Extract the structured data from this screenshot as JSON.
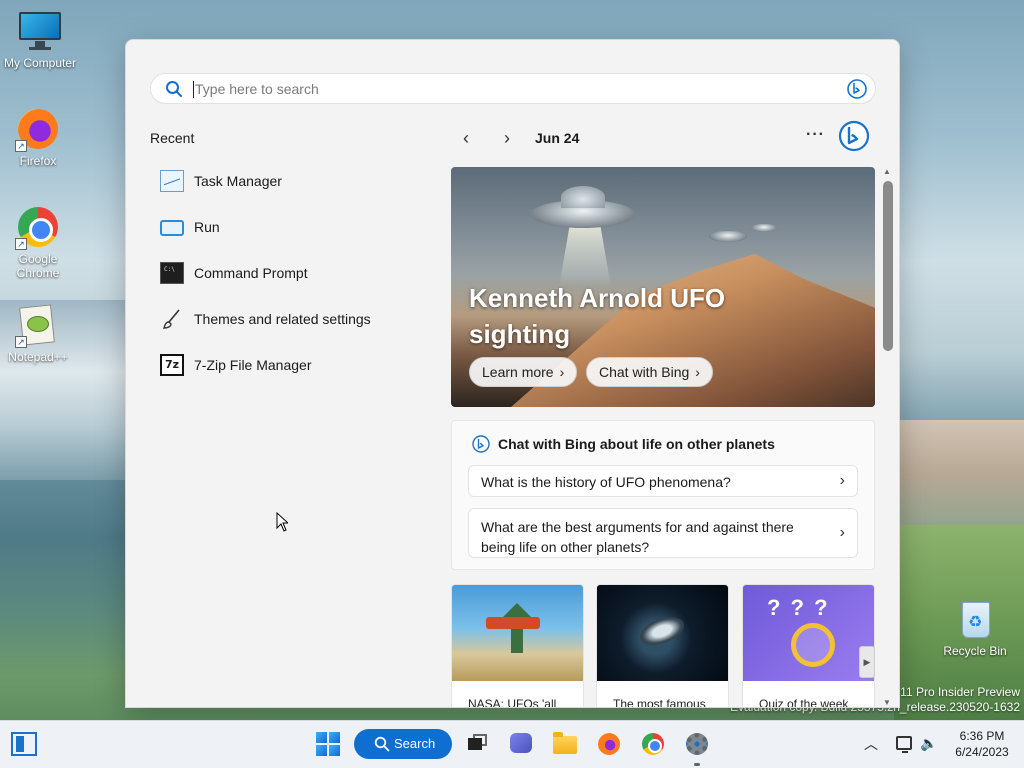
{
  "desktop": {
    "icons": [
      {
        "label": "My Computer",
        "icon": "monitor-icon"
      },
      {
        "label": "Firefox",
        "icon": "firefox-icon"
      },
      {
        "label": "Google Chrome",
        "icon": "chrome-icon"
      },
      {
        "label": "Notepad++",
        "icon": "notepad-plus-plus-icon"
      },
      {
        "label": "Recycle Bin",
        "icon": "recycle-bin-icon"
      }
    ],
    "watermark": {
      "line1": "s 11 Pro Insider Preview",
      "line2": "Evaluation copy. Build 25375.zn_release.230520-1632"
    }
  },
  "search_panel": {
    "search": {
      "placeholder": "Type here to search",
      "value": ""
    },
    "recent": {
      "title": "Recent",
      "items": [
        {
          "label": "Task Manager",
          "icon": "task-manager-icon"
        },
        {
          "label": "Run",
          "icon": "run-icon"
        },
        {
          "label": "Command Prompt",
          "icon": "command-prompt-icon"
        },
        {
          "label": "Themes and related settings",
          "icon": "brush-icon"
        },
        {
          "label": "7-Zip File Manager",
          "icon": "seven-zip-icon"
        }
      ]
    },
    "highlights": {
      "date": "Jun 24",
      "more_label": "···",
      "hero": {
        "title": "Kenneth Arnold UFO sighting",
        "learn_more": "Learn more",
        "chat_with_bing": "Chat with Bing",
        "chevron": "›"
      },
      "bing_chat": {
        "title": "Chat with Bing about life on other planets",
        "questions": [
          "What is the history of UFO phenomena?",
          "What are the best arguments for and against there being life on other planets?"
        ],
        "chevron": "›"
      },
      "tiles": [
        {
          "caption": "NASA: UFOs 'all"
        },
        {
          "caption": "The most famous"
        },
        {
          "caption": "Quiz of the week"
        }
      ]
    }
  },
  "taskbar": {
    "search_label": "Search",
    "tray": {
      "chevron": "︿",
      "volume": "🔈",
      "time": "6:36 PM",
      "date": "6/24/2023"
    }
  },
  "colors": {
    "accent": "#0f6fd0",
    "panel_bg": "#f3f3f3",
    "taskbar_bg": "#eef1f5"
  }
}
